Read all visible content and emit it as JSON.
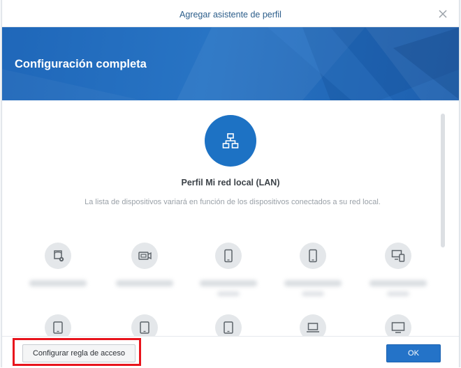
{
  "dialog": {
    "title": "Agregar asistente de perfil",
    "heading": "Configuración completa"
  },
  "profile": {
    "name": "Perfil Mi red local (LAN)",
    "description": "La lista de dispositivos variará en función de los dispositivos conectados a su red local.",
    "icon": "network-icon"
  },
  "devices": [
    {
      "icon": "gaming-console-icon"
    },
    {
      "icon": "camera-icon"
    },
    {
      "icon": "phone-icon"
    },
    {
      "icon": "phone-icon"
    },
    {
      "icon": "multi-device-icon"
    },
    {
      "icon": "tablet-icon"
    },
    {
      "icon": "tablet-icon"
    },
    {
      "icon": "tablet-icon"
    },
    {
      "icon": "laptop-icon"
    },
    {
      "icon": "monitor-icon"
    }
  ],
  "footer": {
    "access_rule_label": "Configurar regla de acceso",
    "ok_label": "OK"
  },
  "colors": {
    "hero_blue": "#1f67b9",
    "primary_button": "#2473c8",
    "highlight": "#e8141c"
  }
}
